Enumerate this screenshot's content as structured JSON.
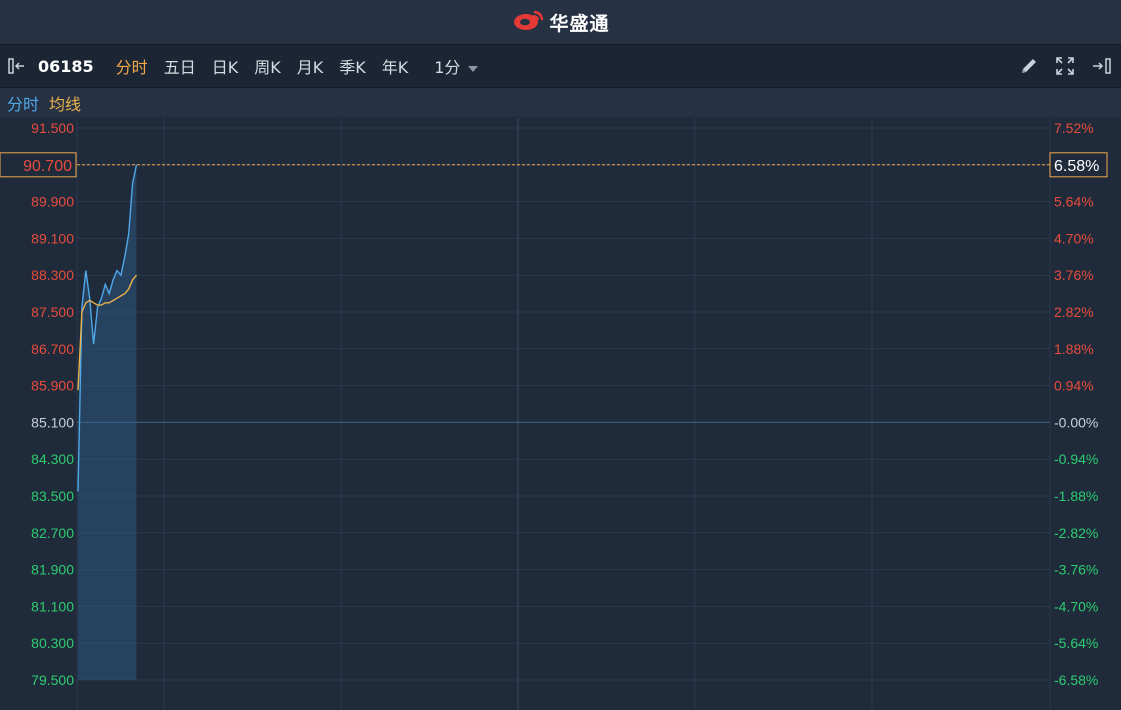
{
  "app": {
    "title": "华盛通",
    "brand_color": "#e53935"
  },
  "toolbar": {
    "collapse_icon": "collapse-left-icon",
    "stock_code": "06185",
    "tabs": [
      {
        "label": "分时",
        "active": true
      },
      {
        "label": "五日",
        "active": false
      },
      {
        "label": "日K",
        "active": false
      },
      {
        "label": "周K",
        "active": false
      },
      {
        "label": "月K",
        "active": false
      },
      {
        "label": "季K",
        "active": false
      },
      {
        "label": "年K",
        "active": false
      }
    ],
    "interval": "1分",
    "right_icons": [
      "pencil-icon",
      "fullscreen-icon",
      "expand-right-icon"
    ]
  },
  "legend": {
    "price_label": "分时",
    "price_color": "#4fa8ea",
    "avg_label": "均线",
    "avg_color": "#e9b24a"
  },
  "chart_data": {
    "type": "line",
    "prev_close": 85.1,
    "current_price": "90.700",
    "current_pct": "6.58%",
    "y_ticks": [
      "91.500",
      "90.700",
      "89.900",
      "89.100",
      "88.300",
      "87.500",
      "86.700",
      "85.900",
      "85.100",
      "84.300",
      "83.500",
      "82.700",
      "81.900",
      "81.100",
      "80.300",
      "79.500"
    ],
    "pct_ticks": [
      "7.52%",
      "6.58%",
      "5.64%",
      "4.70%",
      "3.76%",
      "2.82%",
      "1.88%",
      "0.94%",
      "-0.00%",
      "-0.94%",
      "-1.88%",
      "-2.82%",
      "-3.76%",
      "-4.70%",
      "-5.64%",
      "-6.58%"
    ],
    "ylim": [
      79.5,
      91.5
    ],
    "series": [
      {
        "name": "分时",
        "x": [
          0,
          1,
          2,
          3,
          4,
          5,
          6,
          7,
          8,
          9,
          10,
          11,
          12,
          13,
          14,
          15,
          16,
          17,
          18,
          19,
          20
        ],
        "values": [
          83.6,
          87.6,
          88.4,
          87.8,
          86.8,
          87.6,
          87.8,
          88.1,
          87.9,
          88.2,
          88.4,
          88.3,
          88.7,
          89.2,
          90.3,
          90.7,
          null,
          null,
          null,
          null,
          null
        ]
      },
      {
        "name": "均线",
        "x": [
          0,
          1,
          2,
          3,
          4,
          5,
          6,
          7,
          8,
          9,
          10,
          11,
          12,
          13,
          14,
          15
        ],
        "values": [
          85.8,
          87.5,
          87.7,
          87.75,
          87.7,
          87.65,
          87.65,
          87.7,
          87.7,
          87.75,
          87.8,
          87.85,
          87.9,
          88.0,
          88.2,
          88.3
        ]
      }
    ],
    "up_color": "#e74c3c",
    "down_color": "#2ecc71",
    "neutral_color": "#c7d0da",
    "marker_color": "#f0a94e",
    "grid": true
  }
}
